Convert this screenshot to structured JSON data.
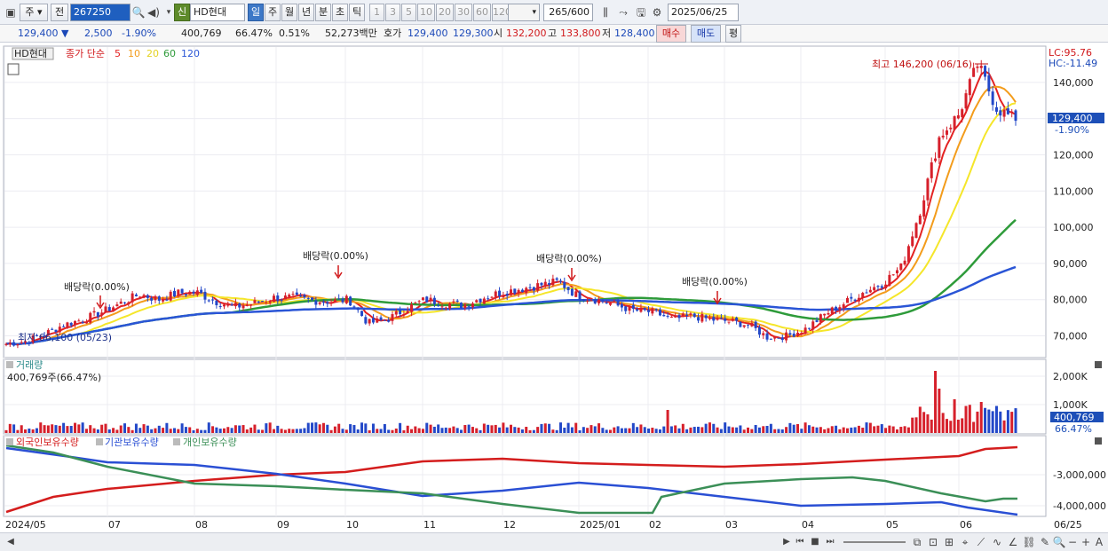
{
  "toolbar": {
    "period_type": "주",
    "prev_label": "전",
    "stock_code": "267250",
    "new_badge": "신",
    "stock_name": "HD현대",
    "period_tabs": [
      "일",
      "주",
      "월",
      "년",
      "분",
      "초",
      "틱"
    ],
    "active_tab": "일",
    "intervals": [
      "1",
      "3",
      "5",
      "10",
      "20",
      "30",
      "60",
      "120"
    ],
    "count": "265",
    "count_total": "/600",
    "date": "2025/06/25"
  },
  "quote": {
    "price": "129,400",
    "change": "2,500",
    "change_pct": "-1.90%",
    "volume": "400,769",
    "volume_ratio": "66.47%",
    "turnover": "0.51%",
    "amount": "52,273백만",
    "bid_label": "호가",
    "ask": "129,400",
    "bid": "129,300",
    "open_label": "시",
    "open": "132,200",
    "high_label": "고",
    "high": "133,800",
    "low_label": "저",
    "low": "128,400",
    "buy_label": "매수",
    "sell_label": "매도",
    "eval_label": "평"
  },
  "legend": {
    "name": "HD현대",
    "title": "종가 단순",
    "ma_labels": [
      "5",
      "10",
      "20",
      "60",
      "120"
    ],
    "lc": "LC:95.76",
    "hc": "HC:-11.49"
  },
  "colors": {
    "ma5": "#e32323",
    "ma10": "#f39c1b",
    "ma20": "#f5e62a",
    "ma60": "#2e9b3a",
    "ma120": "#2a55d6",
    "up": "#d6202b",
    "down": "#2348c8",
    "foreign": "#d41d1d",
    "institution": "#2a4fd4",
    "individual": "#3b8f57"
  },
  "chart_data": [
    {
      "type": "candlestick",
      "title": "HD현대",
      "ylim": [
        64000,
        150000
      ],
      "yticks": [
        "140,000",
        "130,000",
        "120,000",
        "110,000",
        "100,000",
        "90,000",
        "80,000",
        "70,000"
      ],
      "x_labels": [
        "2024/05",
        "07",
        "08",
        "09",
        "10",
        "11",
        "12",
        "2025/01",
        "02",
        "03",
        "04",
        "05",
        "06",
        "06/25"
      ],
      "price_tag": "129,400",
      "price_tag_pct": "-1.90%",
      "annotations": [
        "최고 146,200 (06/16)",
        "최저 66,100 (05/23)",
        "배당락(0.00%)",
        "배당락(0.00%)",
        "배당락(0.00%)",
        "배당락(0.00%)"
      ],
      "close_path": [
        67800,
        68500,
        70500,
        73000,
        74500,
        76500,
        79000,
        81500,
        80000,
        81800,
        82000,
        79500,
        78000,
        79000,
        80500,
        80500,
        79800,
        79500,
        80000,
        73500,
        74500,
        77500,
        80000,
        79000,
        78500,
        80500,
        82000,
        83000,
        84000,
        85000,
        81000,
        80000,
        78500,
        77000,
        76500,
        74500,
        75500,
        74500,
        74000,
        73000,
        69500,
        70000,
        72000,
        76000,
        79000,
        82000,
        84500,
        89000,
        105000,
        125000,
        131000,
        145000,
        133000,
        129400
      ]
    },
    {
      "type": "bar",
      "title": "거래량",
      "value_label": "400,769주(66.47%)",
      "yticks": [
        "2,000K",
        "1,000K"
      ],
      "last_value": "400,769",
      "last_pct": "66.47%"
    },
    {
      "type": "line",
      "series": [
        {
          "name": "외국인보유수량"
        },
        {
          "name": "기관보유수량"
        },
        {
          "name": "개인보유수량"
        }
      ],
      "yticks": [
        "-3,000,000",
        "-4,000,000"
      ]
    }
  ]
}
